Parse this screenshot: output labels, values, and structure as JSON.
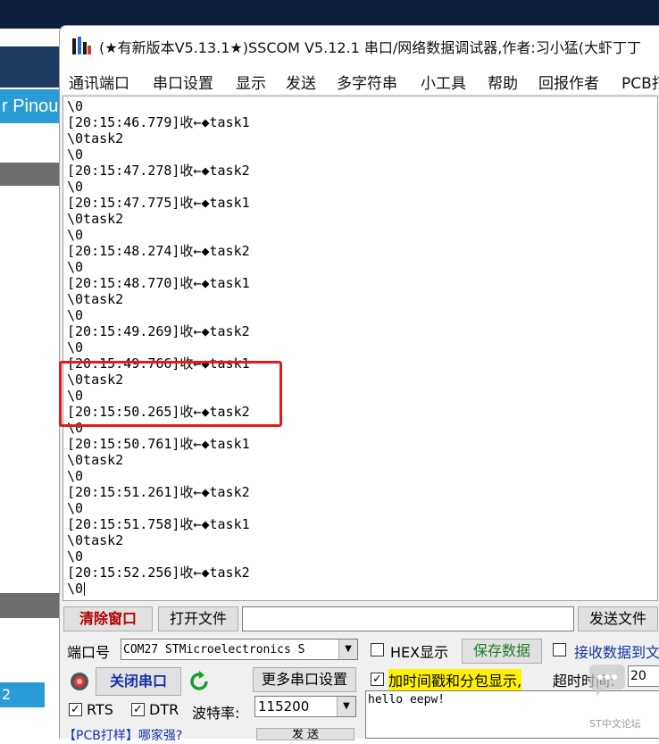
{
  "window": {
    "title": "(★有新版本V5.13.1★)SSCOM V5.12.1 串口/网络数据调试器,作者:习小猛(大虾丁丁"
  },
  "menu": [
    "通讯端口",
    "串口设置",
    "显示",
    "发送",
    "多字符串",
    "小工具",
    "帮助",
    "回报作者",
    "PCB打"
  ],
  "background": {
    "tab_label": "r Pinou",
    "badge": "2"
  },
  "log": {
    "lines": [
      "\\0",
      "[20:15:46.779]收←◆task1",
      "\\0task2",
      "\\0",
      "[20:15:47.278]收←◆task2",
      "\\0",
      "[20:15:47.775]收←◆task1",
      "\\0task2",
      "\\0",
      "[20:15:48.274]收←◆task2",
      "\\0",
      "[20:15:48.770]收←◆task1",
      "\\0task2",
      "\\0",
      "[20:15:49.269]收←◆task2",
      "\\0",
      "[20:15:49.766]收←◆task1",
      "\\0task2",
      "\\0",
      "[20:15:50.265]收←◆task2",
      "\\0",
      "[20:15:50.761]收←◆task1",
      "\\0task2",
      "\\0",
      "[20:15:51.261]收←◆task2",
      "\\0",
      "[20:15:51.758]收←◆task1",
      "\\0task2",
      "\\0",
      "[20:15:52.256]收←◆task2",
      "\\0"
    ]
  },
  "controls": {
    "clear_window": "清除窗口",
    "open_file": "打开文件",
    "send_file": "发送文件",
    "port_label": "端口号",
    "port_value": "COM27 STMicroelectronics S",
    "hex_display": "HEX显示",
    "save_data": "保存数据",
    "recv_to_file": "接收数据到文",
    "close_port": "关闭串口",
    "more_settings": "更多串口设置",
    "timestamp_label": "加时间戳和分包显示,",
    "timeout_label": "超时时间:",
    "timeout_value": "20",
    "rts": "RTS",
    "dtr": "DTR",
    "baud_label": "波特率:",
    "baud_value": "115200",
    "send_text": "hello eepw!",
    "pcb_ad": "【PCB打样】哪家强?",
    "send_button": "发 送"
  },
  "watermark": "ST中文论坛",
  "colors": {
    "highlight": "#e21b1b",
    "timestamp_bg": "#fff200"
  }
}
